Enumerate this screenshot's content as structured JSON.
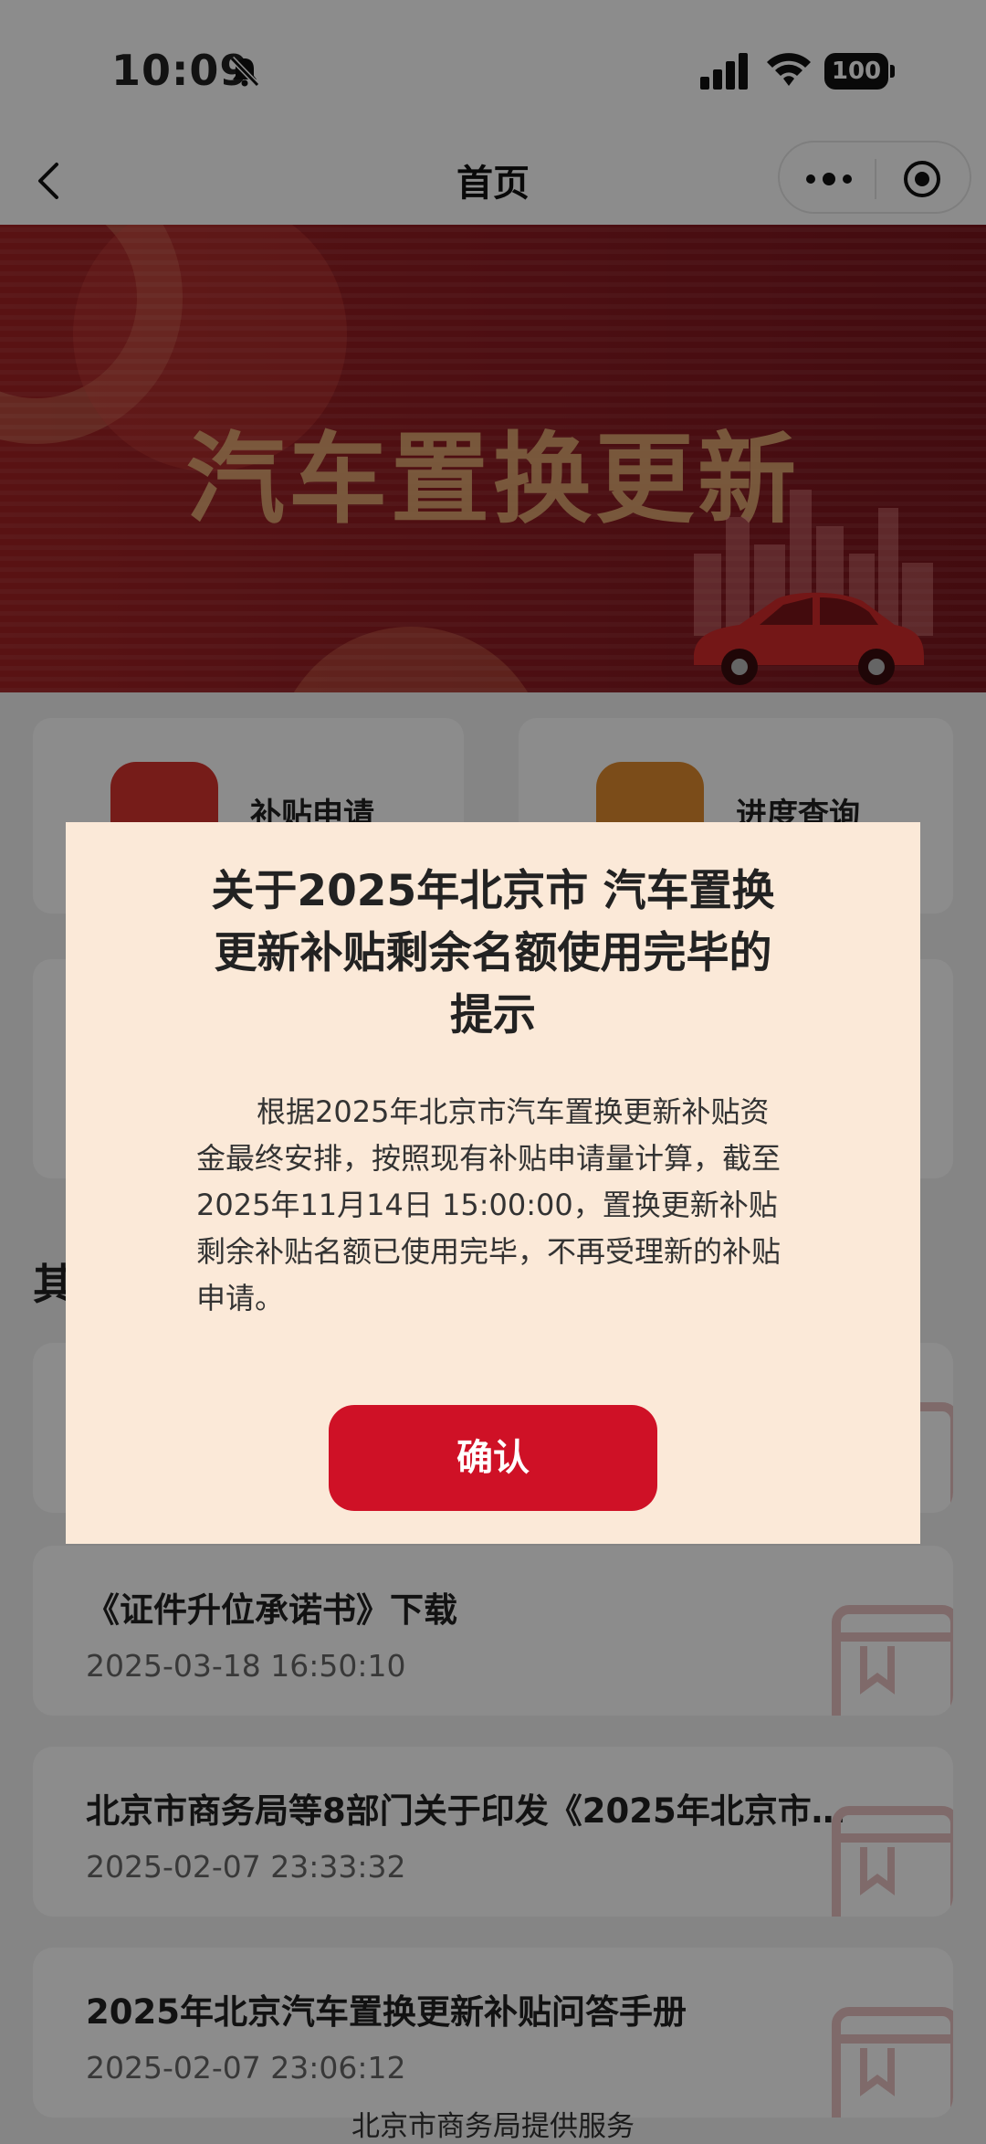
{
  "status_bar": {
    "time": "10:09",
    "battery": "100"
  },
  "nav": {
    "title": "首页"
  },
  "banner": {
    "title": "汽车置换更新"
  },
  "cards": [
    {
      "label": "补贴申请",
      "color": "#d7342f"
    },
    {
      "label": "进度查询",
      "color": "#e08a2e"
    }
  ],
  "section_title": "其",
  "list": [
    {
      "title": "《证件升位承诺书》下载",
      "date": "2025-03-18 16:50:10"
    },
    {
      "title": "北京市商务局等8部门关于印发《2025年北京市…",
      "date": "2025-02-07 23:33:32"
    },
    {
      "title": "2025年北京汽车置换更新补贴问答手册",
      "date": "2025-02-07 23:06:12"
    }
  ],
  "footer": "北京市商务局提供服务",
  "modal": {
    "title": "关于2025年北京市 汽车置换更新补贴剩余名额使用完毕的提示",
    "body": "根据2025年北京市汽车置换更新补贴资金最终安排，按照现有补贴申请量计算，截至2025年11月14日 15:00:00，置换更新补贴剩余补贴名额已使用完毕，不再受理新的补贴申请。",
    "confirm_label": "确认"
  },
  "colors": {
    "accent": "#cf1126",
    "modal_bg": "#fbe9d8",
    "banner_bg": "#8f1c22"
  }
}
